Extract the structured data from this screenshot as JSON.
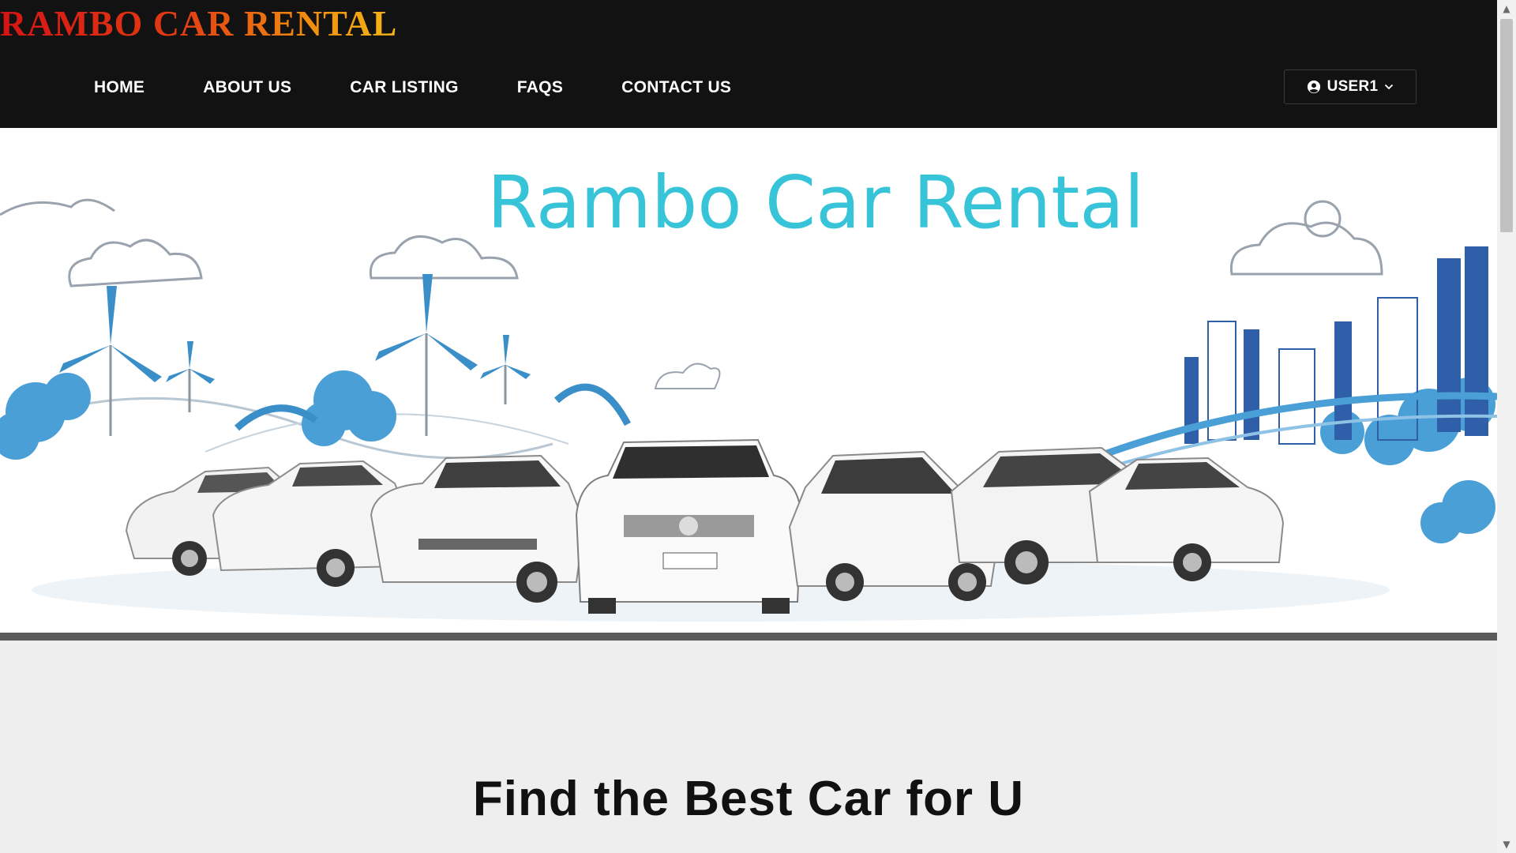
{
  "brand": {
    "title": "RAMBO CAR RENTAL"
  },
  "nav": {
    "items": [
      {
        "label": "HOME"
      },
      {
        "label": "ABOUT US"
      },
      {
        "label": "CAR LISTING"
      },
      {
        "label": "FAQS"
      },
      {
        "label": "CONTACT US"
      }
    ]
  },
  "user_menu": {
    "label": "USER1",
    "icon": "user-circle-icon",
    "caret_icon": "chevron-down-icon"
  },
  "hero": {
    "title": "Rambo Car Rental"
  },
  "section": {
    "title": "Find the Best Car for U"
  },
  "colors": {
    "header_bg": "#121212",
    "brand_gradient": [
      "#d41414",
      "#f2920f",
      "#f4b615"
    ],
    "hero_title": "#38c4d8",
    "page_bg": "#eeeeee",
    "illustration_blue": "#3b8fc9"
  }
}
